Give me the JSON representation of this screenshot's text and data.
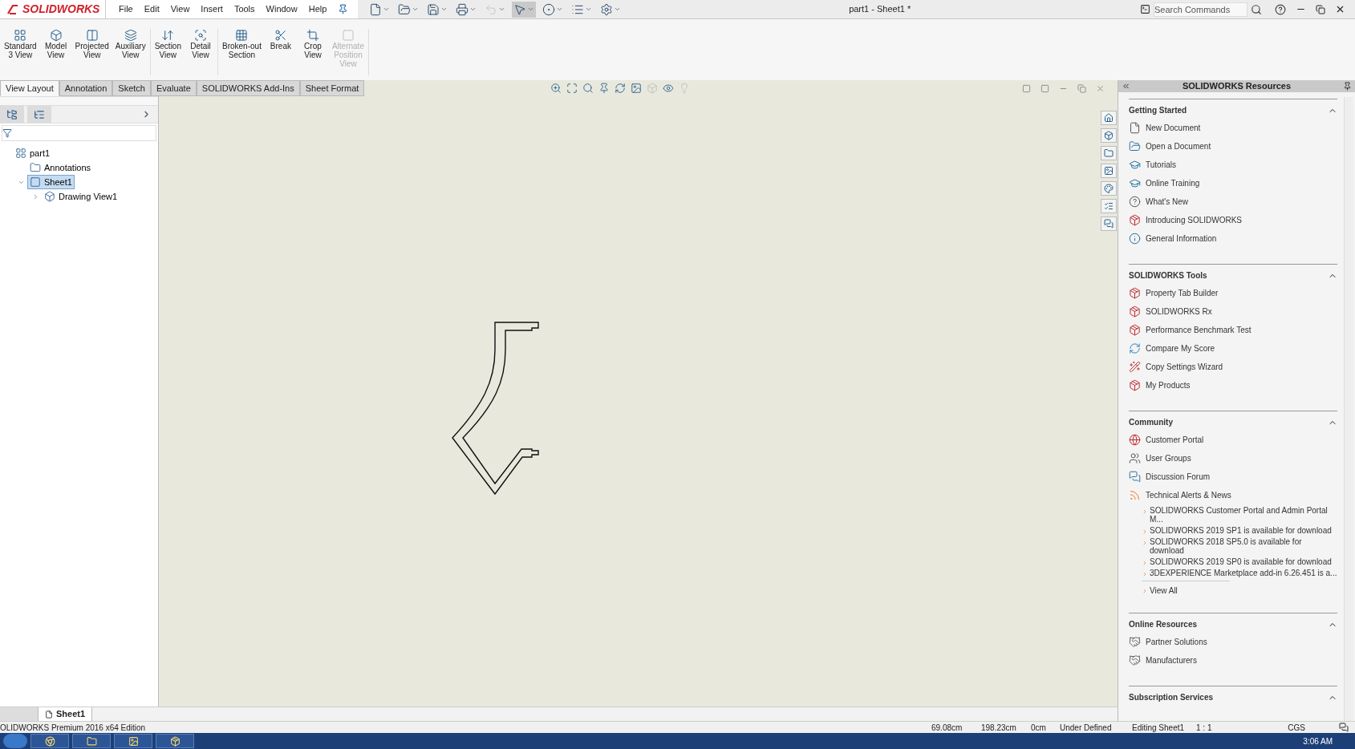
{
  "logo": {
    "text": "SOLIDWORKS"
  },
  "menu": [
    "File",
    "Edit",
    "View",
    "Insert",
    "Tools",
    "Window",
    "Help"
  ],
  "quick_tools": [
    {
      "kind": "new",
      "disabled": false,
      "selected": false
    },
    {
      "kind": "open",
      "disabled": false,
      "selected": false
    },
    {
      "kind": "save",
      "disabled": false,
      "selected": false
    },
    {
      "kind": "print",
      "disabled": false,
      "selected": false
    },
    {
      "kind": "undo",
      "disabled": true,
      "selected": false
    },
    {
      "kind": "select",
      "disabled": false,
      "selected": true
    },
    {
      "kind": "rebuild",
      "disabled": false,
      "selected": false
    },
    {
      "kind": "list",
      "disabled": false,
      "selected": false
    },
    {
      "kind": "options",
      "disabled": false,
      "selected": false
    }
  ],
  "window": {
    "title": "part1 - Sheet1 *"
  },
  "search": {
    "placeholder": "Search Commands"
  },
  "ribbon": [
    [
      {
        "kind": "standard",
        "lines": [
          "Standard",
          "3 View"
        ],
        "disabled": false
      },
      {
        "kind": "model",
        "lines": [
          "Model",
          "View"
        ],
        "disabled": false
      },
      {
        "kind": "projected",
        "lines": [
          "Projected",
          "View"
        ],
        "disabled": false
      },
      {
        "kind": "auxiliary",
        "lines": [
          "Auxiliary",
          "View"
        ],
        "disabled": false
      }
    ],
    [
      {
        "kind": "section",
        "lines": [
          "Section",
          "View"
        ],
        "disabled": false
      },
      {
        "kind": "detail",
        "lines": [
          "Detail",
          "View"
        ],
        "disabled": false
      }
    ],
    [
      {
        "kind": "brokenout",
        "lines": [
          "Broken-out",
          "Section"
        ],
        "disabled": false
      },
      {
        "kind": "break",
        "lines": [
          "Break"
        ],
        "disabled": false
      },
      {
        "kind": "crop",
        "lines": [
          "Crop",
          "View"
        ],
        "disabled": false
      },
      {
        "kind": "alternate",
        "lines": [
          "Alternate",
          "Position",
          "View"
        ],
        "disabled": true
      }
    ]
  ],
  "tabs": [
    {
      "label": "View Layout",
      "selected": true
    },
    {
      "label": "Annotation",
      "selected": false
    },
    {
      "label": "Sketch",
      "selected": false
    },
    {
      "label": "Evaluate",
      "selected": false
    },
    {
      "label": "SOLIDWORKS Add-Ins",
      "selected": false
    },
    {
      "label": "Sheet Format",
      "selected": false
    }
  ],
  "tree": [
    {
      "label": "part1",
      "kind": "part",
      "selected": false,
      "children": [
        {
          "label": "Annotations",
          "kind": "annotations",
          "selected": false
        },
        {
          "label": "Sheet1",
          "kind": "sheet",
          "selected": true,
          "expanded": true,
          "children": [
            {
              "label": "Drawing View1",
              "kind": "view",
              "selected": false,
              "expanded": false
            }
          ]
        }
      ]
    }
  ],
  "resources": {
    "title": "SOLIDWORKS Resources",
    "sections": [
      {
        "title": "Getting Started",
        "expanded": true,
        "items": [
          {
            "label": "New Document",
            "kind": "doc"
          },
          {
            "label": "Open a Document",
            "kind": "open"
          },
          {
            "label": "Tutorials",
            "kind": "cap"
          },
          {
            "label": "Online Training",
            "kind": "cap"
          },
          {
            "label": "What's New",
            "kind": "help"
          },
          {
            "label": "Introducing SOLIDWORKS",
            "kind": "sw"
          },
          {
            "label": "General Information",
            "kind": "info"
          }
        ]
      },
      {
        "title": "SOLIDWORKS Tools",
        "expanded": true,
        "items": [
          {
            "label": "Property Tab Builder",
            "kind": "sw"
          },
          {
            "label": "SOLIDWORKS Rx",
            "kind": "sw"
          },
          {
            "label": "Performance Benchmark Test",
            "kind": "sw"
          },
          {
            "label": "Compare My Score",
            "kind": "score"
          },
          {
            "label": "Copy Settings Wizard",
            "kind": "wizard"
          },
          {
            "label": "My Products",
            "kind": "sw"
          }
        ]
      },
      {
        "title": "Community",
        "expanded": true,
        "items": [
          {
            "label": "Customer Portal",
            "kind": "globe"
          },
          {
            "label": "User Groups",
            "kind": "users"
          },
          {
            "label": "Discussion Forum",
            "kind": "chat"
          },
          {
            "label": "Technical Alerts & News",
            "kind": "rss"
          }
        ],
        "news": [
          "SOLIDWORKS Customer Portal and Admin Portal M...",
          "SOLIDWORKS 2019 SP1 is available for download",
          "SOLIDWORKS 2018 SP5.0 is available for download",
          "SOLIDWORKS 2019 SP0 is available for download",
          "3DEXPERIENCE Marketplace add-in 6.26.451 is a..."
        ],
        "view_all": "View All"
      },
      {
        "title": "Online Resources",
        "expanded": true,
        "items": [
          {
            "label": "Partner Solutions",
            "kind": "hands"
          },
          {
            "label": "Manufacturers",
            "kind": "hands"
          }
        ]
      },
      {
        "title": "Subscription Services",
        "expanded": true
      }
    ]
  },
  "sheet_tabs": [
    {
      "label": "Sheet1",
      "selected": true
    }
  ],
  "status_bar": {
    "edition": "OLIDWORKS Premium 2016 x64 Edition",
    "x": "69.08cm",
    "y": "198.23cm",
    "z": "0cm",
    "state": "Under Defined",
    "editing": "Editing Sheet1",
    "scale": "1 : 1",
    "units": "CGS"
  },
  "taskbar": {
    "time": "3:06 AM"
  }
}
